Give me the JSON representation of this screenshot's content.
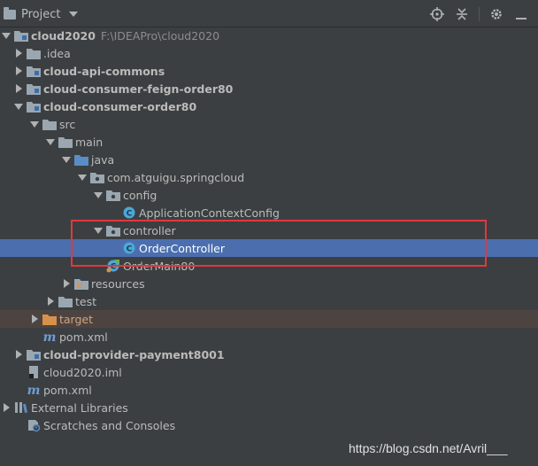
{
  "panel": {
    "title": "Project"
  },
  "tree": {
    "root_name": "cloud2020",
    "root_path": "F:\\IDEAPro\\cloud2020",
    "idea": ".idea",
    "api_commons": "cloud-api-commons",
    "feign_order": "cloud-consumer-feign-order80",
    "consumer_order": "cloud-consumer-order80",
    "src": "src",
    "main": "main",
    "java": "java",
    "package": "com.atguigu.springcloud",
    "config": "config",
    "app_context_config": "ApplicationContextConfig",
    "controller": "controller",
    "order_controller": "OrderController",
    "order_main": "OrderMain80",
    "resources": "resources",
    "test": "test",
    "target": "target",
    "order_pom": "pom.xml",
    "payment": "cloud-provider-payment8001",
    "iml": "cloud2020.iml",
    "root_pom": "pom.xml",
    "external_libraries": "External Libraries",
    "scratches": "Scratches and Consoles"
  },
  "watermark": "https://blog.csdn.net/Avril___",
  "colors": {
    "background": "#3c3f41",
    "selection": "#4b6eaf",
    "excluded": "#4d4441",
    "highlight_box": "#e0393e",
    "folder": "#9aa7b0",
    "source_folder": "#5a8dc6",
    "target_folder": "#d8914b",
    "class_icon": "#4aa8d8"
  }
}
